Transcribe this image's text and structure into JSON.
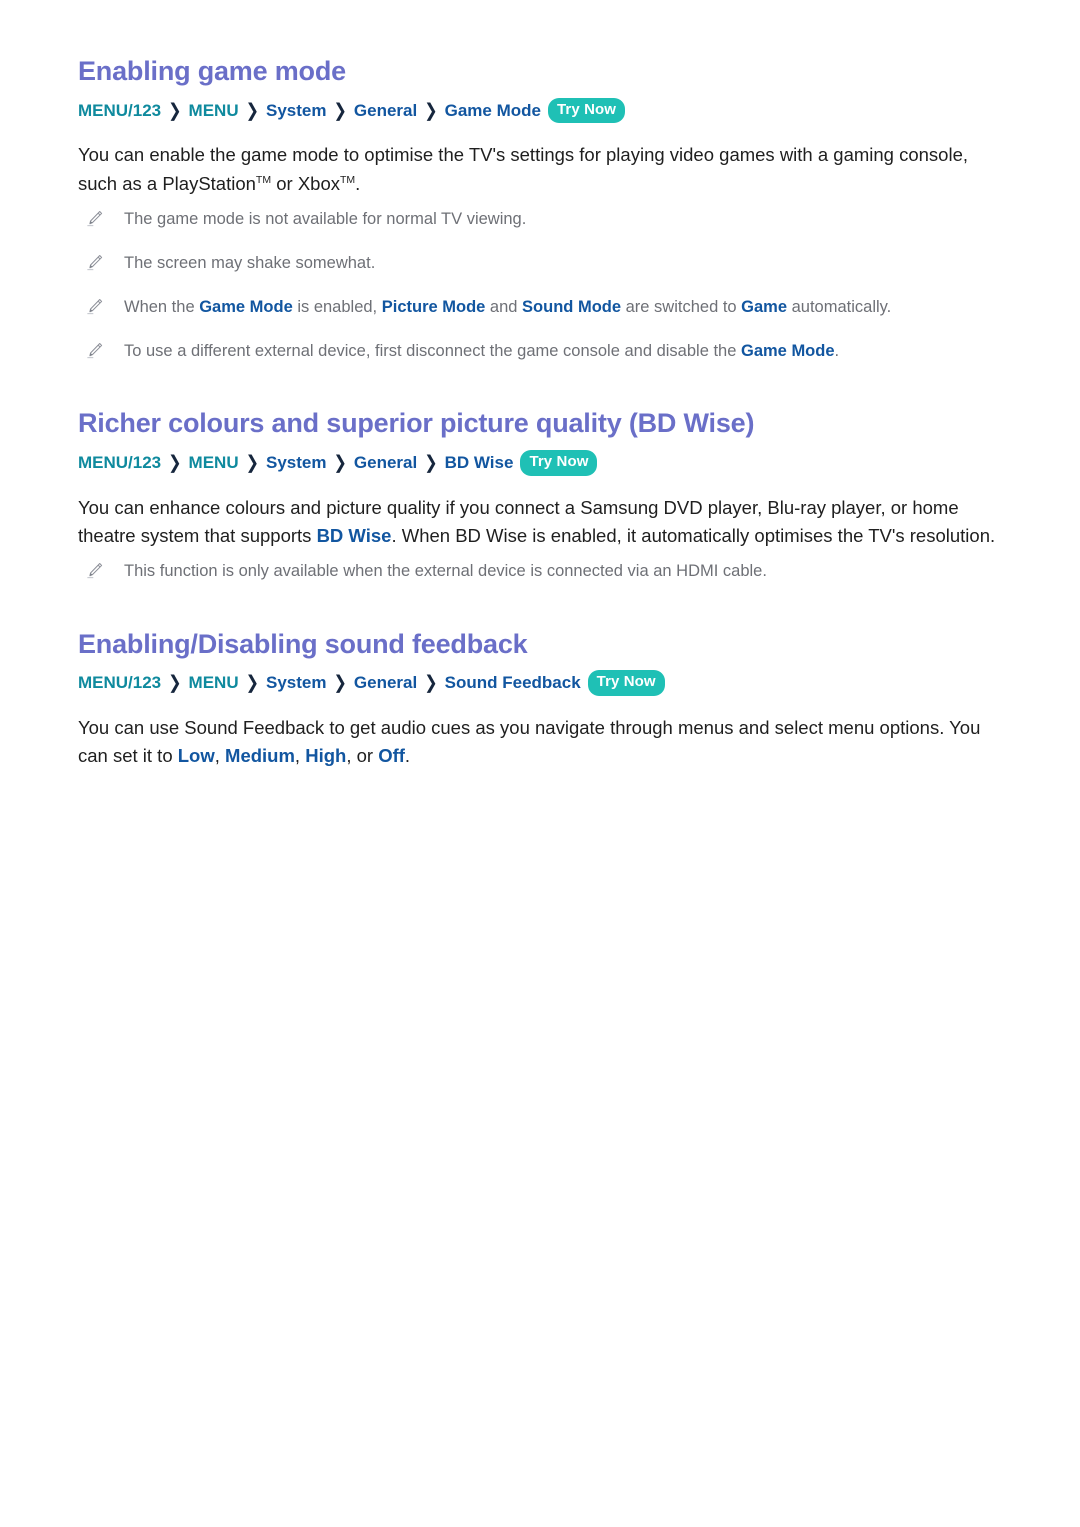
{
  "document": {
    "sections": [
      {
        "heading": "Enabling game mode",
        "breadcrumb": {
          "items": [
            {
              "label": "MENU/123",
              "style": "teal"
            },
            {
              "label": "MENU",
              "style": "teal"
            },
            {
              "label": "System",
              "style": "blue"
            },
            {
              "label": "General",
              "style": "blue"
            },
            {
              "label": "Game Mode",
              "style": "blue"
            }
          ],
          "separator": "❯",
          "badge": "Try Now"
        },
        "paragraphs": [
          {
            "parts": [
              {
                "text": "You can enable the game mode to optimise the TV's settings for playing video games with a gaming console, such as a PlayStation",
                "kind": "plain"
              },
              {
                "text": "TM",
                "kind": "sup"
              },
              {
                "text": " or Xbox",
                "kind": "plain"
              },
              {
                "text": "TM",
                "kind": "sup"
              },
              {
                "text": ".",
                "kind": "plain"
              }
            ]
          }
        ],
        "notes": [
          {
            "parts": [
              {
                "text": "The game mode is not available for normal TV viewing.",
                "kind": "plain"
              }
            ]
          },
          {
            "parts": [
              {
                "text": "The screen may shake somewhat.",
                "kind": "plain"
              }
            ]
          },
          {
            "parts": [
              {
                "text": "When the ",
                "kind": "plain"
              },
              {
                "text": "Game Mode",
                "kind": "kw"
              },
              {
                "text": " is enabled, ",
                "kind": "plain"
              },
              {
                "text": "Picture Mode",
                "kind": "kw"
              },
              {
                "text": " and ",
                "kind": "plain"
              },
              {
                "text": "Sound Mode",
                "kind": "kw"
              },
              {
                "text": " are switched to ",
                "kind": "plain"
              },
              {
                "text": "Game",
                "kind": "kw"
              },
              {
                "text": " automatically.",
                "kind": "plain"
              }
            ]
          },
          {
            "parts": [
              {
                "text": "To use a different external device, first disconnect the game console and disable the ",
                "kind": "plain"
              },
              {
                "text": "Game Mode",
                "kind": "kw"
              },
              {
                "text": ".",
                "kind": "plain"
              }
            ]
          }
        ]
      },
      {
        "heading": "Richer colours and superior picture quality (BD Wise)",
        "breadcrumb": {
          "items": [
            {
              "label": "MENU/123",
              "style": "teal"
            },
            {
              "label": "MENU",
              "style": "teal"
            },
            {
              "label": "System",
              "style": "blue"
            },
            {
              "label": "General",
              "style": "blue"
            },
            {
              "label": "BD Wise",
              "style": "blue"
            }
          ],
          "separator": "❯",
          "badge": "Try Now"
        },
        "paragraphs": [
          {
            "parts": [
              {
                "text": "You can enhance colours and picture quality if you connect a Samsung DVD player, Blu-ray player, or home theatre system that supports ",
                "kind": "plain"
              },
              {
                "text": "BD Wise",
                "kind": "kw"
              },
              {
                "text": ". When BD Wise is enabled, it automatically optimises the TV's resolution.",
                "kind": "plain"
              }
            ]
          }
        ],
        "notes": [
          {
            "parts": [
              {
                "text": "This function is only available when the external device is connected via an HDMI cable.",
                "kind": "plain"
              }
            ]
          }
        ]
      },
      {
        "heading": "Enabling/Disabling sound feedback",
        "breadcrumb": {
          "items": [
            {
              "label": "MENU/123",
              "style": "teal"
            },
            {
              "label": "MENU",
              "style": "teal"
            },
            {
              "label": "System",
              "style": "blue"
            },
            {
              "label": "General",
              "style": "blue"
            },
            {
              "label": "Sound Feedback",
              "style": "blue"
            }
          ],
          "separator": "❯",
          "badge": "Try Now"
        },
        "paragraphs": [
          {
            "parts": [
              {
                "text": "You can use Sound Feedback to get audio cues as you navigate through menus and select menu options. You can set it to ",
                "kind": "plain"
              },
              {
                "text": "Low",
                "kind": "kw"
              },
              {
                "text": ", ",
                "kind": "plain"
              },
              {
                "text": "Medium",
                "kind": "kw"
              },
              {
                "text": ", ",
                "kind": "plain"
              },
              {
                "text": "High",
                "kind": "kw"
              },
              {
                "text": ", or ",
                "kind": "plain"
              },
              {
                "text": "Off",
                "kind": "kw"
              },
              {
                "text": ".",
                "kind": "plain"
              }
            ]
          }
        ],
        "notes": []
      }
    ],
    "colors": {
      "heading": "#6a6fc8",
      "crumb_teal": "#0f8a9e",
      "crumb_blue": "#1256a0",
      "badge_bg": "#1fc0b5",
      "badge_text": "#ffffff",
      "body_text": "#1f1f1f",
      "note_text": "#6e7076",
      "keyword": "#1256a0"
    },
    "icons": {
      "note_bullet": "pencil-icon"
    }
  }
}
